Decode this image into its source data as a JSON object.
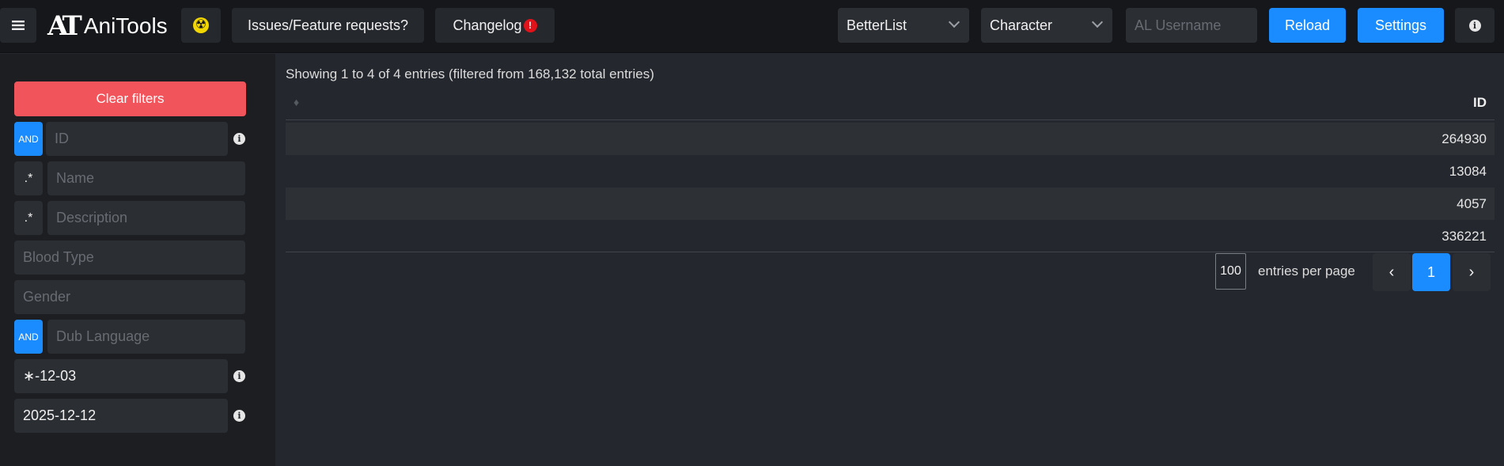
{
  "app": {
    "name": "AniTools",
    "logo_mark": "AT"
  },
  "header": {
    "issues_label": "Issues/Feature requests?",
    "changelog_label": "Changelog",
    "changelog_badge": "!",
    "list_select": "BetterList",
    "type_select": "Character",
    "username_placeholder": "AL Username",
    "reload_label": "Reload",
    "settings_label": "Settings",
    "accent_color": "#1a8cff"
  },
  "sidebar": {
    "clear_label": "Clear filters",
    "and_label": "AND",
    "regex_label": ".*",
    "fields": {
      "id": {
        "placeholder": "ID",
        "value": ""
      },
      "name": {
        "placeholder": "Name",
        "value": ""
      },
      "description": {
        "placeholder": "Description",
        "value": ""
      },
      "blood_type": {
        "placeholder": "Blood Type",
        "value": ""
      },
      "gender": {
        "placeholder": "Gender",
        "value": ""
      },
      "dub_language": {
        "placeholder": "Dub Language",
        "value": ""
      },
      "birthday": {
        "value": "∗-12-03"
      },
      "date": {
        "value": "2025-12-12"
      }
    },
    "clear_color": "#f2545b"
  },
  "table": {
    "summary": "Showing 1 to 4 of 4 entries (filtered from 168,132 total entries)",
    "columns": [
      "ID"
    ],
    "rows": [
      {
        "id": "264930"
      },
      {
        "id": "13084"
      },
      {
        "id": "4057"
      },
      {
        "id": "336221"
      }
    ]
  },
  "pagination": {
    "per_page": "100",
    "per_page_label": "entries per page",
    "prev": "‹",
    "current": "1",
    "next": "›"
  }
}
